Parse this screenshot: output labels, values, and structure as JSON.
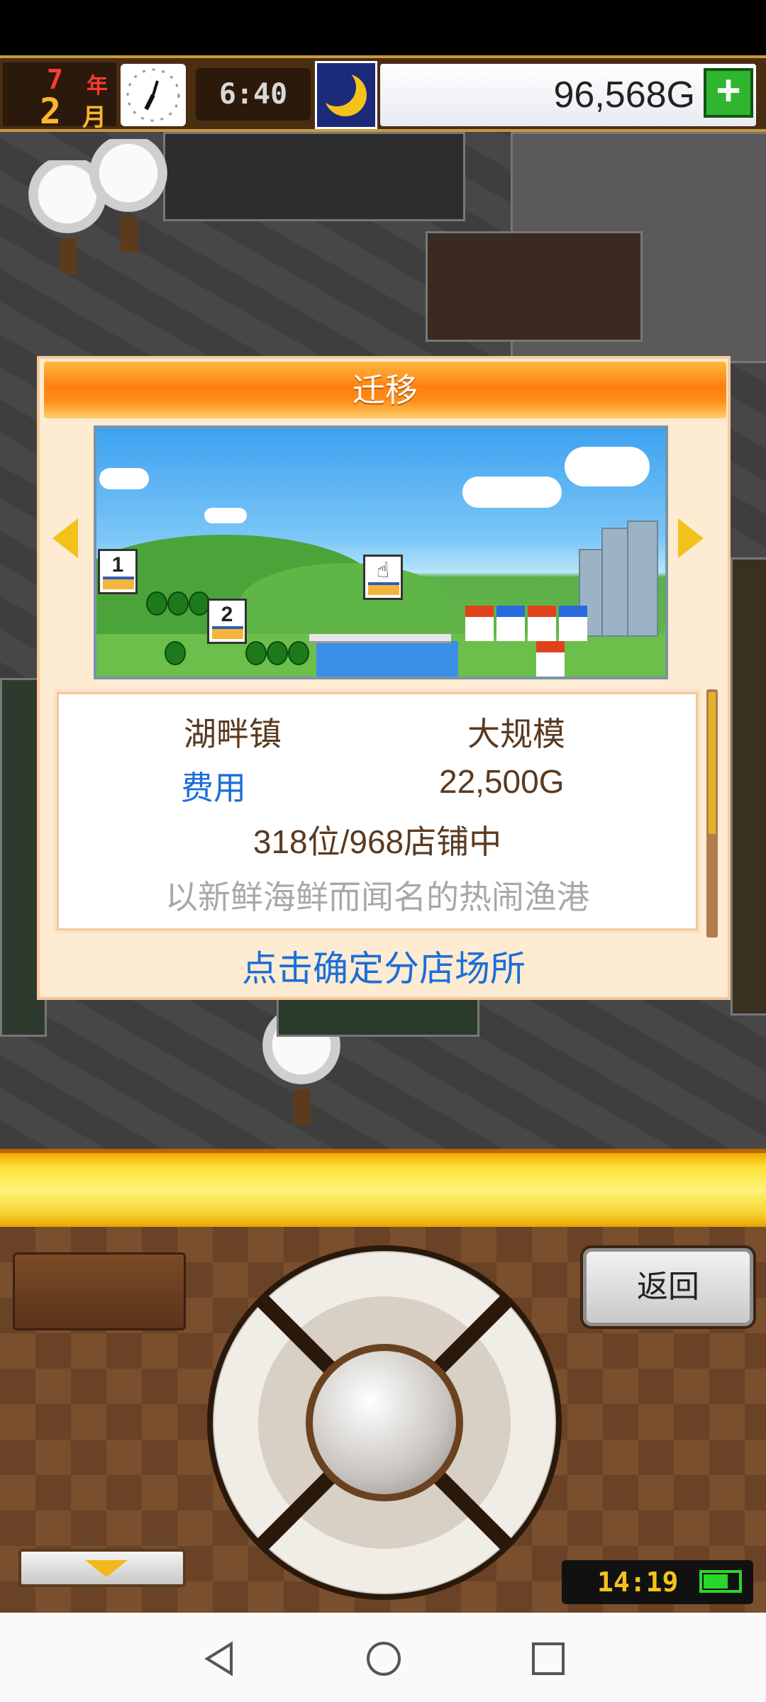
{
  "status": {
    "year_num": "7",
    "year_unit": "年",
    "month_num": "2",
    "month_unit": "月",
    "time": "6:40",
    "money": "96,568G",
    "add_money_icon": "plus-icon",
    "weather_icon": "moon-icon",
    "clock_icon": "analog-clock-icon"
  },
  "dialog": {
    "title": "迁移",
    "prev_icon": "arrow-left-icon",
    "next_icon": "arrow-right-icon",
    "map_markers": [
      "1",
      "2",
      ""
    ],
    "info": {
      "town": "湖畔镇",
      "scale": "大规模",
      "fee_label": "费用",
      "fee_value": "22,500G",
      "rank": "318位/968店铺中",
      "description": "以新鲜海鲜而闻名的热闹渔港"
    },
    "confirm": "点击确定分店场所"
  },
  "controller": {
    "back_label": "返回",
    "menu_toggle_icon": "triangle-down-icon",
    "clock_time": "14:19",
    "battery_icon": "battery-icon"
  },
  "navbar": {
    "back_icon": "nav-back-icon",
    "home_icon": "nav-home-icon",
    "recent_icon": "nav-recent-icon"
  },
  "colors": {
    "title_orange": "#ff8f1a",
    "link_blue": "#1a6ed9",
    "text_brown": "#5a3a20",
    "gold": "#f2c21b"
  }
}
